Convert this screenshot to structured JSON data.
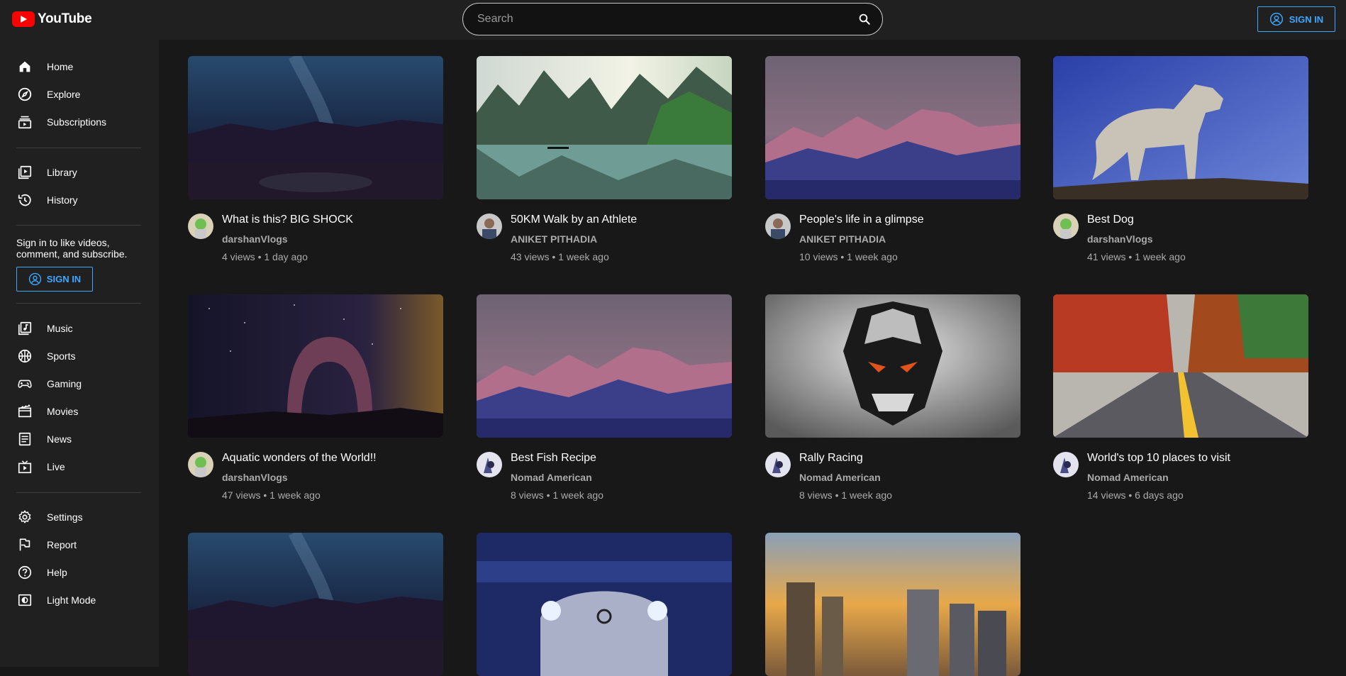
{
  "header": {
    "app_name": "YouTube",
    "search_placeholder": "Search",
    "sign_in_label": "SIGN IN"
  },
  "sidebar": {
    "primary": [
      {
        "label": "Home",
        "icon": "home-icon"
      },
      {
        "label": "Explore",
        "icon": "compass-icon"
      },
      {
        "label": "Subscriptions",
        "icon": "subscriptions-icon"
      }
    ],
    "library": [
      {
        "label": "Library",
        "icon": "library-icon"
      },
      {
        "label": "History",
        "icon": "history-icon"
      }
    ],
    "sign_in_message": "Sign in to like videos, comment, and subscribe.",
    "sign_in_label": "SIGN IN",
    "explore": [
      {
        "label": "Music",
        "icon": "music-icon"
      },
      {
        "label": "Sports",
        "icon": "sports-icon"
      },
      {
        "label": "Gaming",
        "icon": "gaming-icon"
      },
      {
        "label": "Movies",
        "icon": "movies-icon"
      },
      {
        "label": "News",
        "icon": "news-icon"
      },
      {
        "label": "Live",
        "icon": "live-icon"
      }
    ],
    "settings": [
      {
        "label": "Settings",
        "icon": "gear-icon"
      },
      {
        "label": "Report",
        "icon": "flag-icon"
      },
      {
        "label": "Help",
        "icon": "help-icon"
      },
      {
        "label": "Light Mode",
        "icon": "light-mode-icon"
      }
    ]
  },
  "videos": [
    {
      "title": "What is this? BIG SHOCK",
      "channel": "darshanVlogs",
      "stats": "4 views • 1 day ago"
    },
    {
      "title": "50KM Walk by an Athlete",
      "channel": "ANIKET PITHADIA",
      "stats": "43 views • 1 week ago"
    },
    {
      "title": "People's life in a glimpse",
      "channel": "ANIKET PITHADIA",
      "stats": "10 views • 1 week ago"
    },
    {
      "title": "Best Dog",
      "channel": "darshanVlogs",
      "stats": "41 views • 1 week ago"
    },
    {
      "title": "Aquatic wonders of the World!!",
      "channel": "darshanVlogs",
      "stats": "47 views • 1 week ago"
    },
    {
      "title": "Best Fish Recipe",
      "channel": "Nomad American",
      "stats": "8 views • 1 week ago"
    },
    {
      "title": "Rally Racing",
      "channel": "Nomad American",
      "stats": "8 views • 1 week ago"
    },
    {
      "title": "World's top 10 places to visit",
      "channel": "Nomad American",
      "stats": "14 views • 6 days ago"
    },
    {
      "title": "",
      "channel": "",
      "stats": ""
    },
    {
      "title": "",
      "channel": "",
      "stats": ""
    },
    {
      "title": "",
      "channel": "",
      "stats": ""
    }
  ],
  "colors": {
    "accent": "#3ea6ff",
    "brand": "#ff0000",
    "background": "#181818",
    "surface": "#202020"
  }
}
